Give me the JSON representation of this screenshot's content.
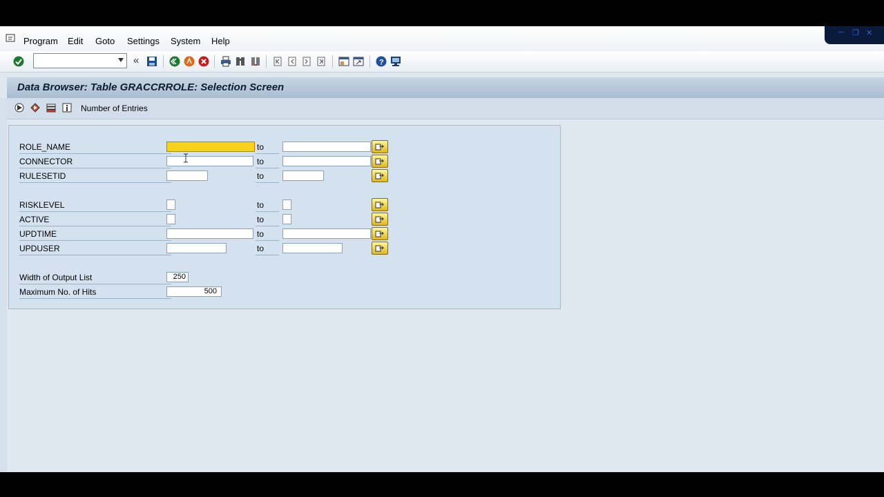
{
  "menu": {
    "items": [
      "Program",
      "Edit",
      "Goto",
      "Settings",
      "System",
      "Help"
    ]
  },
  "toolbar": {
    "command_value": "",
    "icons": [
      "enter-icon",
      "back-icon",
      "save-icon",
      "back-green-icon",
      "exit-icon",
      "cancel-icon",
      "print-icon",
      "find-icon",
      "find-next-icon",
      "first-page-icon",
      "prev-page-icon",
      "next-page-icon",
      "last-page-icon",
      "new-session-icon",
      "shortcut-icon",
      "help-icon",
      "layout-icon"
    ]
  },
  "title": "Data Browser: Table GRACCRROLE: Selection Screen",
  "app_toolbar": {
    "number_of_entries": "Number of Entries"
  },
  "fields": [
    {
      "label": "ROLE_NAME",
      "from": "",
      "to_label": "to",
      "to": ""
    },
    {
      "label": "CONNECTOR",
      "from": "",
      "to_label": "to",
      "to": ""
    },
    {
      "label": "RULESETID",
      "from": "",
      "to_label": "to",
      "to": ""
    },
    {
      "label": "RISKLEVEL",
      "from": "",
      "to_label": "to",
      "to": ""
    },
    {
      "label": "ACTIVE",
      "from": "",
      "to_label": "to",
      "to": ""
    },
    {
      "label": "UPDTIME",
      "from": "",
      "to_label": "to",
      "to": ""
    },
    {
      "label": "UPDUSER",
      "from": "",
      "to_label": "to",
      "to": ""
    }
  ],
  "settings": {
    "width_label": "Width of Output List",
    "width_value": "250",
    "max_hits_label": "Maximum No. of Hits",
    "max_hits_value": "500"
  },
  "colors": {
    "active_field": "#f6d31a",
    "panel_bg": "#d4e1ee",
    "title_bg": "#a8bdd0"
  }
}
